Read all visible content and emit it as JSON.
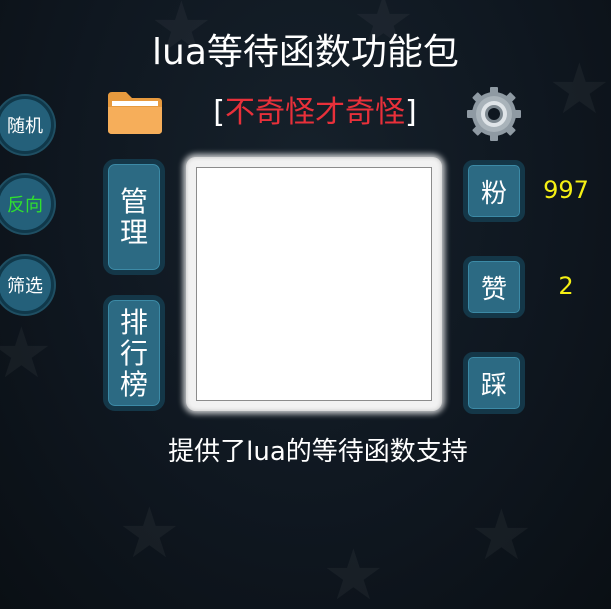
{
  "title": "lua等待函数功能包",
  "package_name": {
    "left_bracket": "[",
    "text": "不奇怪才奇怪",
    "right_bracket": "]"
  },
  "side_buttons": {
    "random": "随机",
    "reverse": "反向",
    "filter": "筛选"
  },
  "panel_buttons": {
    "manage": "管理",
    "ranking": "排行榜"
  },
  "stats": {
    "fans_label": "粉",
    "fans_count": "997",
    "like_label": "赞",
    "like_count": "2",
    "dislike_label": "踩"
  },
  "description": "提供了lua的等待函数支持",
  "icons": {
    "folder": "folder-icon",
    "settings": "gear-icon"
  },
  "colors": {
    "package_name": "#e8303a",
    "counts": "#f5f014",
    "reverse_label": "#2fe02f",
    "button_fill": "#2c6a83"
  }
}
